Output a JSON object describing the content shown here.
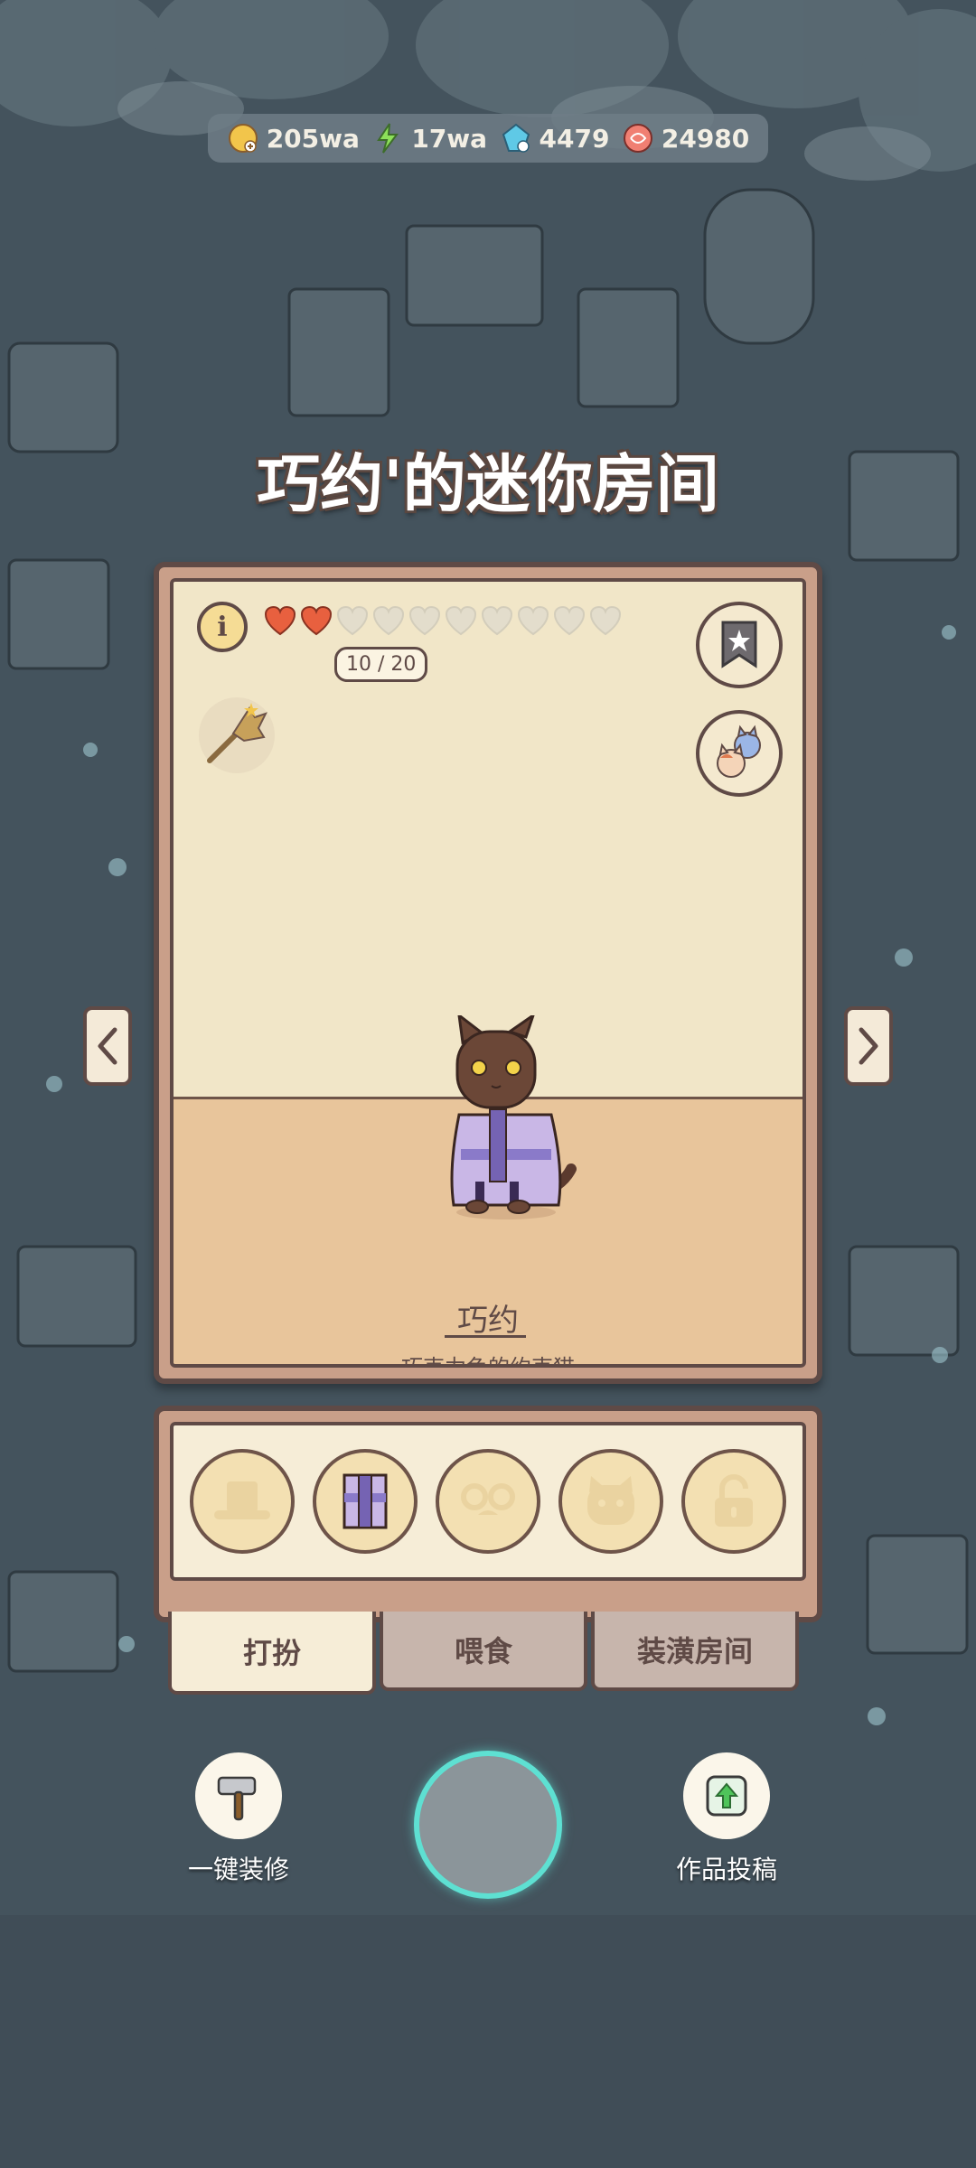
{
  "currency": [
    {
      "icon": "coin-icon",
      "value": "205wa"
    },
    {
      "icon": "energy-icon",
      "value": "17wa"
    },
    {
      "icon": "gem-icon",
      "value": "4479"
    },
    {
      "icon": "candy-icon",
      "value": "24980"
    }
  ],
  "room": {
    "title": "巧约'的迷你房间",
    "hearts_filled": 2,
    "hearts_total": 10,
    "heart_count": "10 / 20",
    "cat_name": "巧约",
    "cat_desc": "巧克力色的约克猫"
  },
  "outfit_slots": [
    "hat-slot",
    "clothes-slot",
    "glasses-slot",
    "face-slot",
    "locked-slot"
  ],
  "tabs": [
    {
      "label": "打扮",
      "active": true
    },
    {
      "label": "喂食",
      "active": false
    },
    {
      "label": "装潢房间",
      "active": false
    }
  ],
  "actions": {
    "renovate_label": "一键装修",
    "submit_label": "作品投稿"
  },
  "colors": {
    "frame": "#5f4a46",
    "wall": "#f1e6c8",
    "floor": "#e8c59b",
    "accent_ring": "#5ee0d2",
    "heart": "#e8603f"
  }
}
